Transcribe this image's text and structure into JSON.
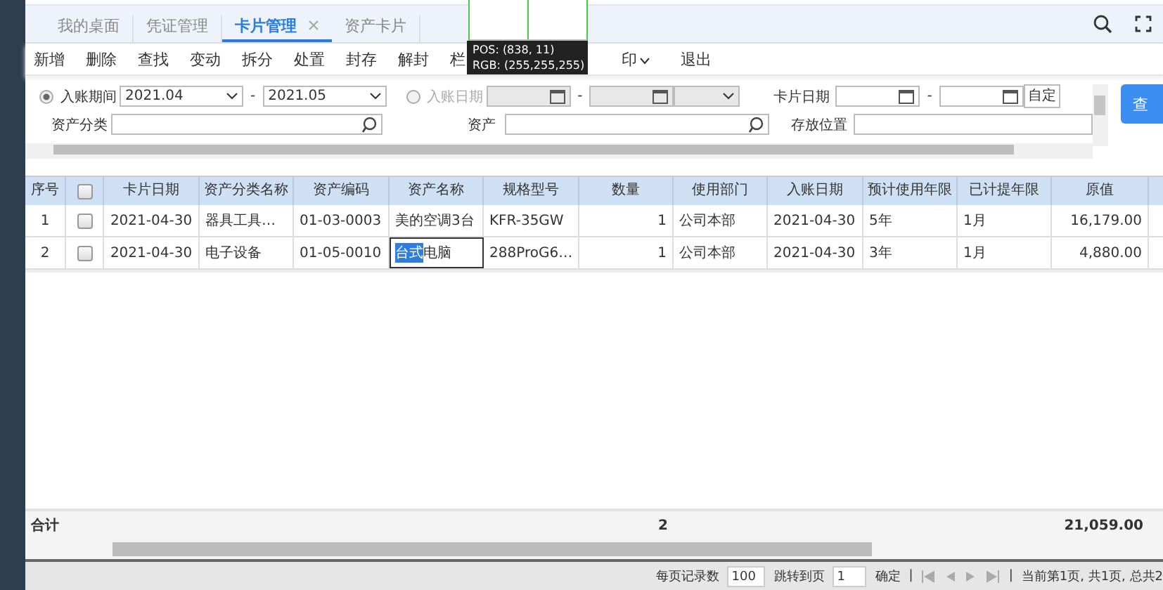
{
  "tabs": [
    {
      "label": "我的桌面",
      "selected": false,
      "closable": false
    },
    {
      "label": "凭证管理",
      "selected": false,
      "closable": false
    },
    {
      "label": "卡片管理",
      "selected": true,
      "closable": true
    },
    {
      "label": "资产卡片",
      "selected": false,
      "closable": false
    }
  ],
  "toolbar": [
    {
      "label": "新增",
      "kind": "plain"
    },
    {
      "label": "删除",
      "kind": "plain"
    },
    {
      "label": "查找",
      "kind": "plain"
    },
    {
      "label": "变动",
      "kind": "plain"
    },
    {
      "label": "拆分",
      "kind": "plain"
    },
    {
      "label": "处置",
      "kind": "plain"
    },
    {
      "label": "封存",
      "kind": "plain"
    },
    {
      "label": "解封",
      "kind": "plain"
    },
    {
      "label": "栏",
      "kind": "plain"
    },
    {
      "label": "印",
      "kind": "dropdown"
    },
    {
      "label": "退出",
      "kind": "plain"
    }
  ],
  "picker_tooltip": {
    "pos": "POS: (838, 11)",
    "rgb": "RGB: (255,255,255)"
  },
  "filters": {
    "period": {
      "selected": true,
      "label": "入账期间",
      "from": "2021.04",
      "to": "2021.05",
      "dash": "-"
    },
    "entry_date": {
      "selected": false,
      "label": "入账日期",
      "dash": "-"
    },
    "card_date": {
      "label": "卡片日期",
      "dash": "-",
      "custom": "自定"
    },
    "category": {
      "label": "资产分类"
    },
    "asset": {
      "label": "资产"
    },
    "location": {
      "label": "存放位置"
    },
    "query_button": "查"
  },
  "table": {
    "all_checked": false,
    "columns": [
      "序号",
      "",
      "卡片日期",
      "资产分类名称",
      "资产编码",
      "资产名称",
      "规格型号",
      "数量",
      "使用部门",
      "入账日期",
      "预计使用年限",
      "已计提年限",
      "原值"
    ],
    "rows": [
      {
        "no": "1",
        "checked": false,
        "card_date": "2021-04-30",
        "category": "器具工具…",
        "code": "01-03-0003",
        "editing": false,
        "name_parts": [
          {
            "text": "美的空调3台",
            "selected": false
          }
        ],
        "model": "KFR-35GW",
        "qty": "1",
        "dept": "公司本部",
        "entry_date": "2021-04-30",
        "life": "5年",
        "depreciated": "1月",
        "value": "16,179.00"
      },
      {
        "no": "2",
        "checked": false,
        "card_date": "2021-04-30",
        "category": "电子设备",
        "code": "01-05-0010",
        "editing": true,
        "name_parts": [
          {
            "text": "台式",
            "selected": true
          },
          {
            "text": "电脑",
            "selected": false
          }
        ],
        "model": "288ProG6…",
        "qty": "1",
        "dept": "公司本部",
        "entry_date": "2021-04-30",
        "life": "3年",
        "depreciated": "1月",
        "value": "4,880.00"
      }
    ],
    "total": {
      "label": "合计",
      "qty": "2",
      "value": "21,059.00"
    }
  },
  "pager": {
    "per_page_label": "每页记录数",
    "per_page": "100",
    "goto_label": "跳转到页",
    "goto": "1",
    "confirm": "确定",
    "sep": "|",
    "status": "当前第1页, 共1页, 总共2"
  }
}
